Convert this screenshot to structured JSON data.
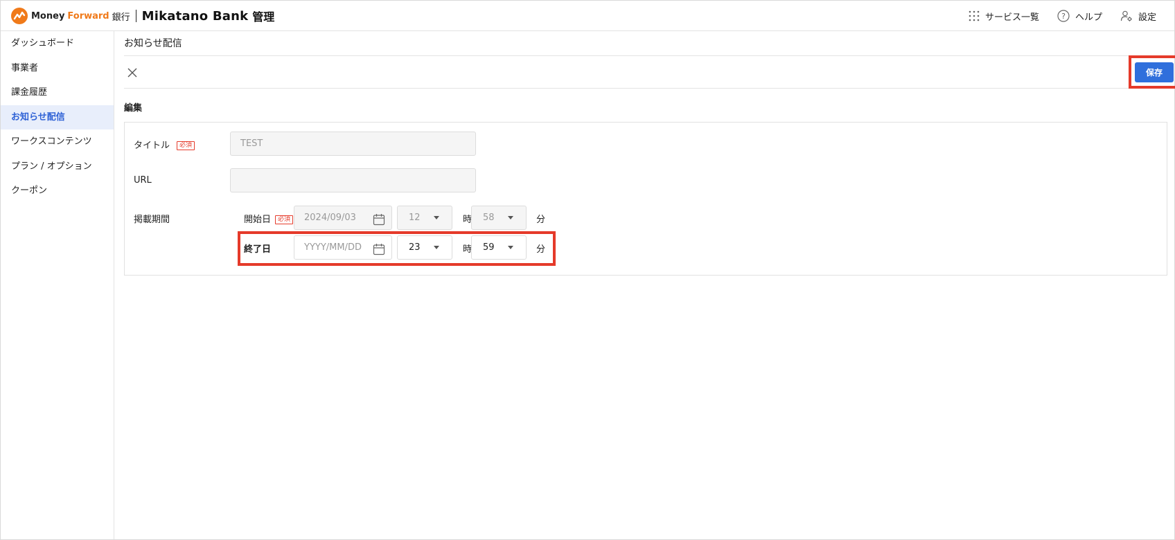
{
  "header": {
    "brand_money": "Money",
    "brand_forward": "Forward",
    "brand_bank": "銀行",
    "product": "Mikatano Bank",
    "product_suffix": "管理",
    "nav": [
      {
        "label": "サービス一覧",
        "icon": "grid-icon"
      },
      {
        "label": "ヘルプ",
        "icon": "help-icon"
      },
      {
        "label": "設定",
        "icon": "user-settings-icon"
      }
    ]
  },
  "sidebar": {
    "items": [
      {
        "label": "ダッシュボード",
        "active": false
      },
      {
        "label": "事業者",
        "active": false
      },
      {
        "label": "課金履歴",
        "active": false
      },
      {
        "label": "お知らせ配信",
        "active": true
      },
      {
        "label": "ワークスコンテンツ",
        "active": false
      },
      {
        "label": "プラン / オプション",
        "active": false
      },
      {
        "label": "クーポン",
        "active": false
      }
    ]
  },
  "main": {
    "page_title": "お知らせ配信",
    "save_label": "保存",
    "section_title": "編集",
    "form": {
      "title_label": "タイトル",
      "required_badge": "必須",
      "title_value": "TEST",
      "url_label": "URL",
      "url_value": "",
      "period_label": "掲載期間",
      "start_label": "開始日",
      "start_date": "2024/09/03",
      "start_hour": "12",
      "start_minute": "58",
      "end_label": "終了日",
      "end_date_placeholder": "YYYY/MM/DD",
      "end_hour": "23",
      "end_minute": "59",
      "hour_unit": "時",
      "minute_unit": "分"
    }
  },
  "colors": {
    "accent": "#2f6fdc",
    "active_nav_bg": "#e8eefb",
    "highlight": "#e53a2a",
    "brand_orange": "#f07a1a"
  }
}
